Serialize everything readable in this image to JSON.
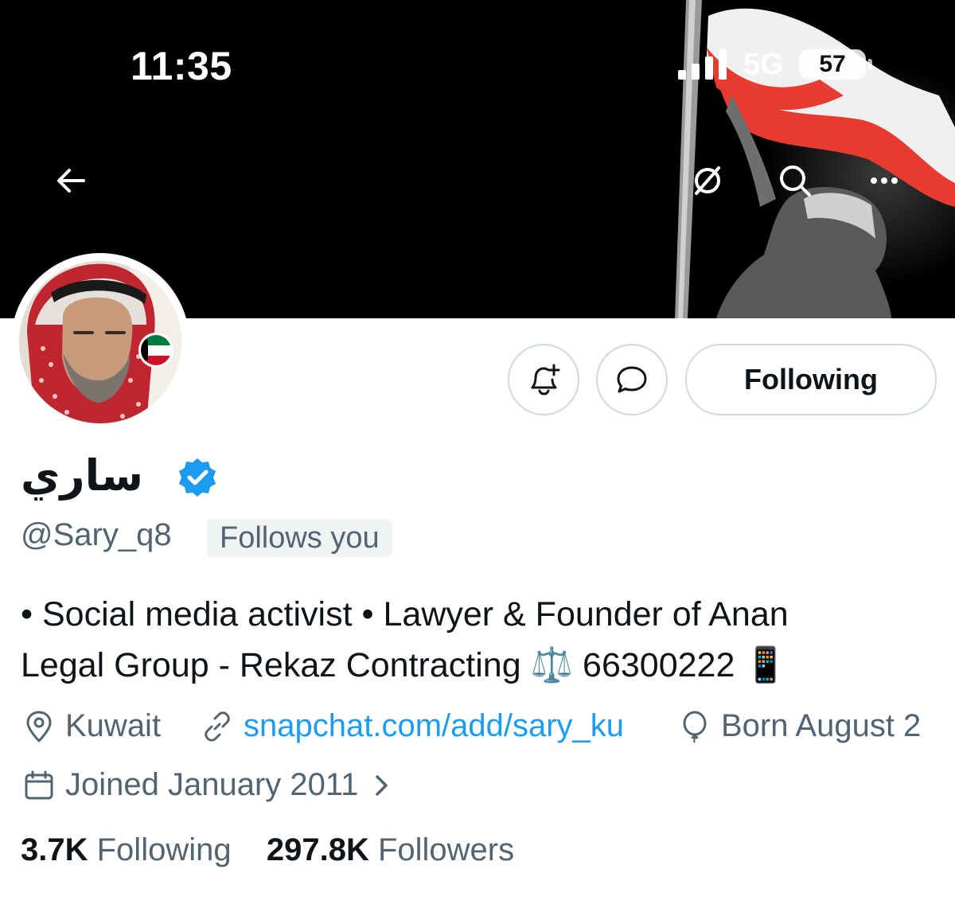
{
  "status_bar": {
    "time": "11:35",
    "network": "5G",
    "battery": "57"
  },
  "banner": {
    "description_icon": "flag-photo-banner"
  },
  "top_bar": {
    "back_icon": "arrow-left-icon",
    "grok_icon": "grok-icon",
    "search_icon": "search-icon",
    "more_icon": "more-icon"
  },
  "actions": {
    "notify_icon": "bell-plus-icon",
    "message_icon": "message-icon",
    "following_label": "Following"
  },
  "profile": {
    "name": "ساري",
    "handle": "@Sary_q8",
    "follows_you": "Follows you",
    "bio_line1": "• Social media activist • Lawyer & Founder of Anan",
    "bio_line2": "Legal Group - Rekaz Contracting ⚖️ 66300222 📱",
    "location": "Kuwait",
    "website": "snapchat.com/add/sary_ku",
    "birthday": "Born August 2",
    "joined": "Joined January 2011"
  },
  "stats": {
    "following_count": "3.7K",
    "following_label": "Following",
    "followers_count": "297.8K",
    "followers_label": "Followers"
  },
  "colors": {
    "accent": "#1d9bf0",
    "secondary_text": "#536471",
    "border": "#cfd9de",
    "kuwait_green": "#007a3d",
    "kuwait_red": "#ce1126"
  }
}
